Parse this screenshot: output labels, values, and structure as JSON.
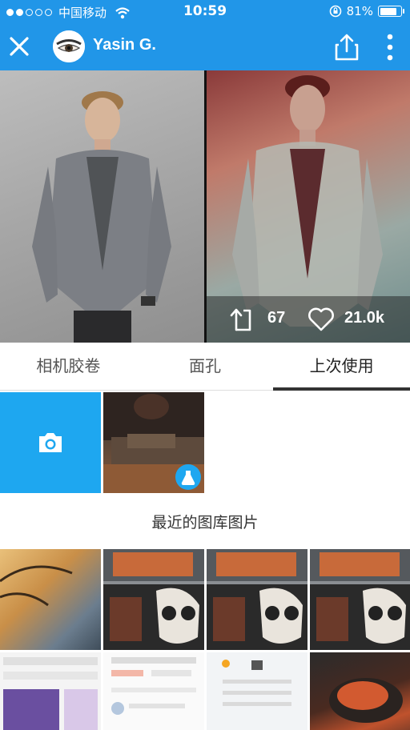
{
  "status_bar": {
    "carrier": "中国移动",
    "time": "10:59",
    "battery_percent": "81%",
    "battery_level": 0.81
  },
  "nav": {
    "user_name": "Yasin G."
  },
  "photo_stats": {
    "reposts": "67",
    "likes": "21.0k"
  },
  "tabs": [
    {
      "label": "相机胶卷",
      "active": false
    },
    {
      "label": "面孔",
      "active": false
    },
    {
      "label": "上次使用",
      "active": true
    }
  ],
  "gallery_section": {
    "title": "最近的图库图片"
  },
  "colors": {
    "brand_blue": "#2196e8",
    "camera_tile": "#1ea7f0"
  },
  "icons": {
    "close": "close-icon",
    "share": "share-icon",
    "more": "more-vertical-icon",
    "repost": "repost-icon",
    "like": "heart-icon",
    "camera": "camera-icon",
    "filter_badge": "flask-icon"
  }
}
